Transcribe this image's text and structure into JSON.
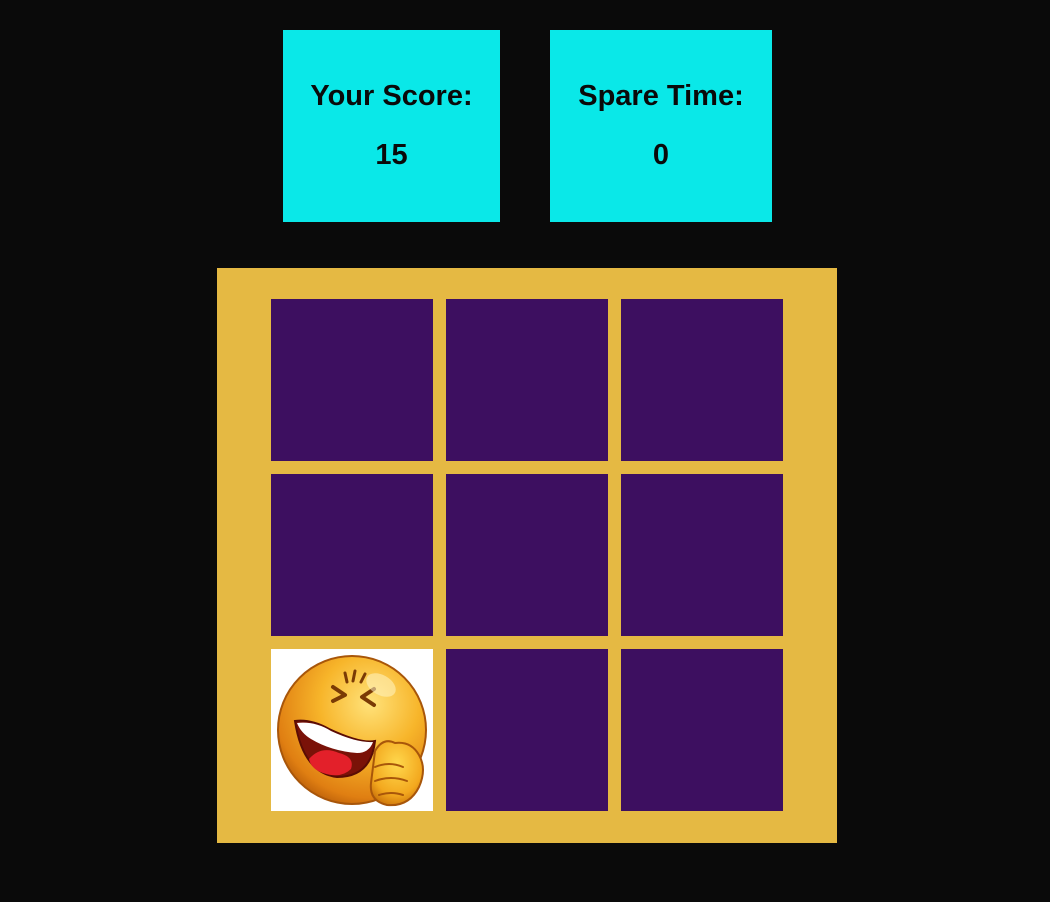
{
  "score": {
    "label": "Your Score:",
    "value": "15"
  },
  "spare_time": {
    "label": "Spare Time:",
    "value": "0"
  },
  "board": {
    "rows": 3,
    "cols": 3,
    "tiles": [
      {
        "state": "hidden"
      },
      {
        "state": "hidden"
      },
      {
        "state": "hidden"
      },
      {
        "state": "hidden"
      },
      {
        "state": "hidden"
      },
      {
        "state": "hidden"
      },
      {
        "state": "revealed",
        "icon": "laughing-emoji-icon"
      },
      {
        "state": "hidden"
      },
      {
        "state": "hidden"
      }
    ]
  },
  "colors": {
    "background": "#0a0a0a",
    "stat_box": "#0ae8e8",
    "board_frame": "#e5b943",
    "tile_hidden": "#3d0f60",
    "tile_revealed": "#ffffff"
  }
}
